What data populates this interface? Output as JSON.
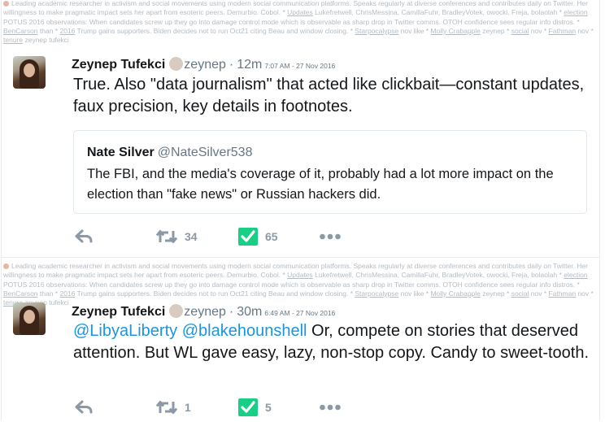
{
  "bio": {
    "text1": "Leading academic researcher in activism and social movements using modern social communication platforms. Speaks regularly at diverse conferences and contributes daily on Twitter. Her willingness to make pragmatic impact sets her apart from esoteric peers. Demurbio. Cobol. * ",
    "tag1": "Updates",
    "text2": " Lukefretwell, ChrisMessina, CamillaFuhr, BradleyVotek, owocki, Freja, bolaolah * ",
    "tag2": "election",
    "text3": " POTUS 2016 observations: When candidates screw up they go into damage control mode which is observable as sharp drop in Twitter comms. OTOH confidence sees regular info distros. * ",
    "tag3": "BenCarson",
    "text4": " than * ",
    "tag4": "2016",
    "text5": " Trump gains supporters. Biden decides not to run Oct21 citing Beau and window closing. * ",
    "tag5": "Starpocalypse",
    "text6": " nov like * ",
    "tag6": "Molly Crabapple",
    "text7": " zeynep * ",
    "tag7": "social",
    "text8": " nov * ",
    "tag8": "Fathman",
    "text9": " nov * ",
    "tag9": "tenure",
    "text10": " zeynep tufekci"
  },
  "tweets": [
    {
      "name": "Zeynep Tufekci",
      "handle": "zeynep",
      "time": "12m",
      "stamp": "7:07 AM - 27 Nov 2016",
      "text": "True. Also \"data journalism\" that acted like clickbait—constant updates, faux precision, key details in footnotes.",
      "quote": {
        "name": "Nate Silver",
        "handle": "@NateSilver538",
        "text": "The FBI, and the media's coverage of it, probably had a lot more impact on the election than \"fake news\" or Russian hackers did."
      },
      "retweets": "34",
      "likes": "65"
    },
    {
      "name": "Zeynep Tufekci",
      "handle": "zeynep",
      "time": "30m",
      "stamp": "6:49 AM - 27 Nov 2016",
      "mention1": "@LibyaLiberty",
      "mention2": "@blakehounshell",
      "text": " Or, compete on stories that deserved attention. But WL gave easy, lazy, non-stop copy. Candy to sweet-tooth.",
      "retweets": "1",
      "likes": "5"
    }
  ],
  "colors": {
    "mention": "#1b95e0",
    "like_box": "#19cf86",
    "muted": "#657786",
    "icon": "#8b98a5"
  }
}
